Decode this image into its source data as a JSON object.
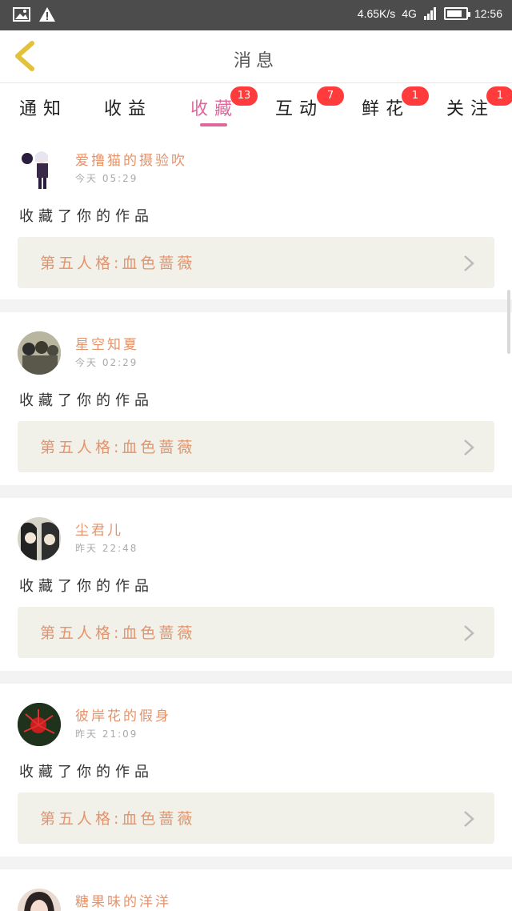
{
  "status_bar": {
    "speed": "4.65K/s",
    "network": "4G",
    "time": "12:56",
    "battery_level": 0.8,
    "left_icons": [
      "image-icon",
      "warning-icon"
    ]
  },
  "header": {
    "title": "消息",
    "back_icon": "chevron-left-icon",
    "back_color": "#e2c23a"
  },
  "tabs": [
    {
      "label": "通知",
      "badge": ""
    },
    {
      "label": "收益",
      "badge": ""
    },
    {
      "label": "收藏",
      "badge": "13",
      "active": true
    },
    {
      "label": "互动",
      "badge": "7"
    },
    {
      "label": "鲜花",
      "badge": "1"
    },
    {
      "label": "关注",
      "badge": "1"
    }
  ],
  "colors": {
    "accent": "#e0679b",
    "username": "#e6926a",
    "badge": "#ff3b3b",
    "work_box_bg": "#f1f1e9"
  },
  "cards": [
    {
      "username": "爱撸猫的摄验吹",
      "time": "今天 05:29",
      "desc": "收藏了你的作品",
      "work": "第五人格:血色蔷薇",
      "avatar_icon": "avatar-anime-character-icon"
    },
    {
      "username": "星空知夏",
      "time": "今天 02:29",
      "desc": "收藏了你的作品",
      "work": "第五人格:血色蔷薇",
      "avatar_icon": "avatar-group-anime-icon"
    },
    {
      "username": "尘君儿",
      "time": "昨天 22:48",
      "desc": "收藏了你的作品",
      "work": "第五人格:血色蔷薇",
      "avatar_icon": "avatar-couple-anime-icon"
    },
    {
      "username": "彼岸花的假身",
      "time": "昨天 21:09",
      "desc": "收藏了你的作品",
      "work": "第五人格:血色蔷薇",
      "avatar_icon": "avatar-red-spider-lily-icon"
    },
    {
      "username": "糖果味的洋洋",
      "time": "",
      "desc": "",
      "work": "",
      "avatar_icon": "avatar-girl-photo-icon"
    }
  ]
}
